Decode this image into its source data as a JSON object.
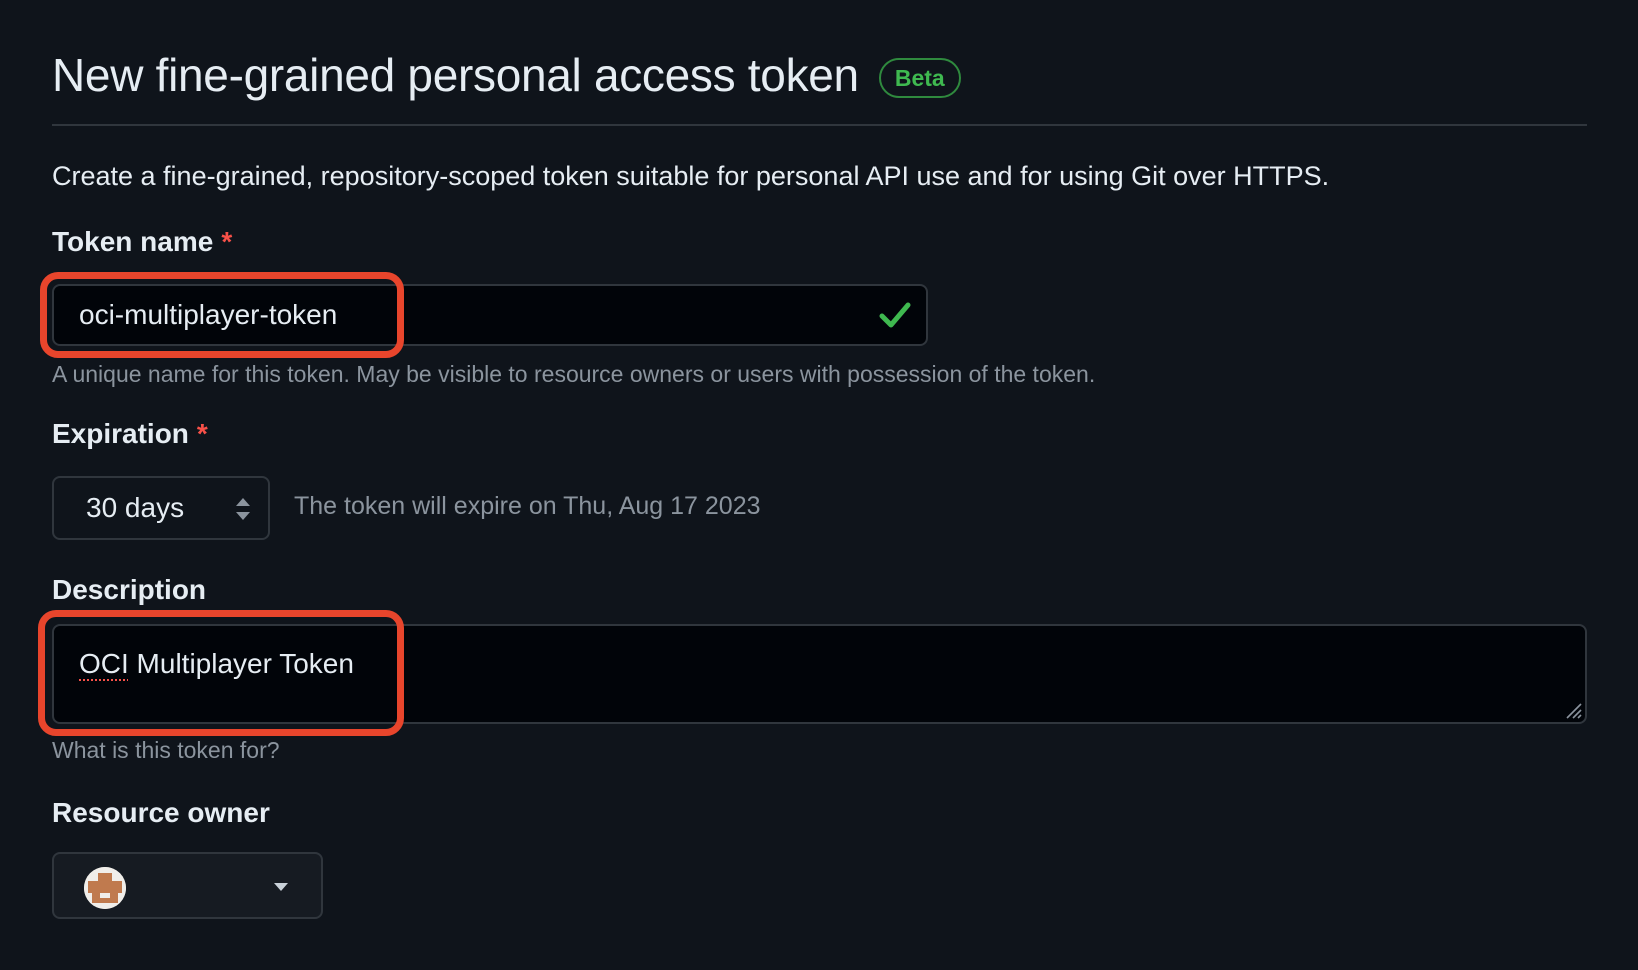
{
  "header": {
    "title": "New fine-grained personal access token",
    "badge": "Beta"
  },
  "intro": "Create a fine-grained, repository-scoped token suitable for personal API use and for using Git over HTTPS.",
  "token_name": {
    "label": "Token name",
    "required_marker": "*",
    "value": "oci-multiplayer-token",
    "hint": "A unique name for this token. May be visible to resource owners or users with possession of the token.",
    "valid_icon": "check-icon"
  },
  "expiration": {
    "label": "Expiration",
    "required_marker": "*",
    "selected": "30 days",
    "note": "The token will expire on Thu, Aug 17 2023"
  },
  "description": {
    "label": "Description",
    "value_part1": "OCI",
    "value_part2": " Multiplayer Token",
    "hint": "What is this token for?"
  },
  "resource_owner": {
    "label": "Resource owner",
    "avatar_icon": "avatar",
    "dropdown_icon": "caret-down-icon"
  },
  "colors": {
    "background": "#0f141b",
    "input_background": "#010409",
    "border": "#30363d",
    "text": "#e6edf3",
    "muted_text": "#8b949e",
    "required": "#f85149",
    "success": "#3fb950",
    "highlight": "#e8452c"
  }
}
